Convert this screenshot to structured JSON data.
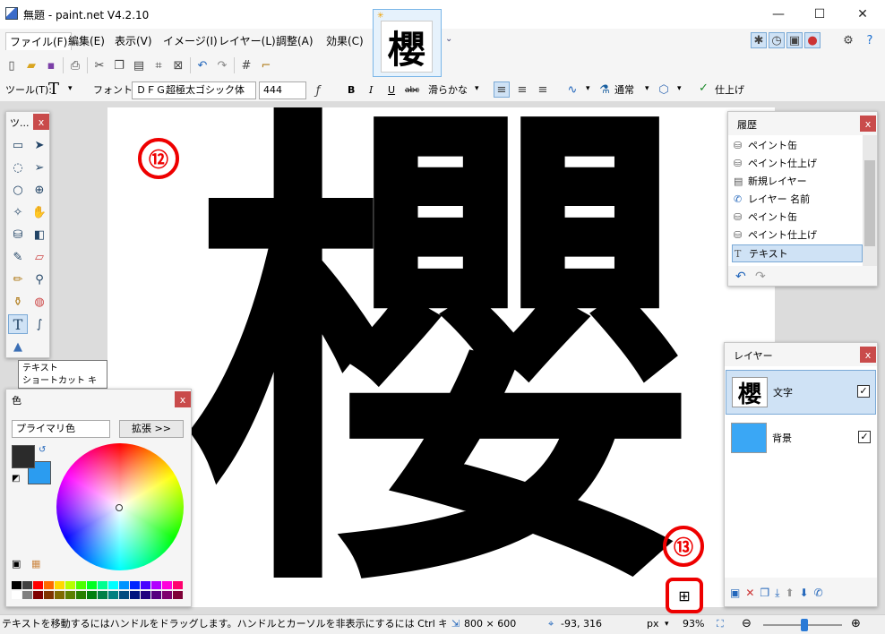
{
  "window": {
    "title": "無題 - paint.net V4.2.10",
    "minimize_glyph": "—",
    "maximize_glyph": "☐",
    "close_glyph": "✕"
  },
  "menu": [
    "ファイル(F)",
    "編集(E)",
    "表示(V)",
    "イメージ(I)",
    "レイヤー(L)",
    "調整(A)",
    "効果(C)"
  ],
  "image_tab": {
    "thumb_char": "櫻"
  },
  "toolbar2": {
    "tool_label": "ツール(T):",
    "tool_glyph": "T",
    "font_label": "フォント:",
    "font_value": "ＤＦＧ超極太ゴシック体",
    "size_value": "444",
    "bold": "B",
    "italic": "I",
    "underline": "U",
    "strike": "abc",
    "antialias": "滑らかな",
    "blend": "通常",
    "finish": "仕上げ"
  },
  "canvas": {
    "text": "櫻",
    "background": "#ffffff"
  },
  "markers": {
    "m12": "⑫",
    "m13": "⑬"
  },
  "tools_panel": {
    "title": "ツ..."
  },
  "tooltip": {
    "line1": "テキスト",
    "line2": "ショートカット キー: T"
  },
  "color_panel": {
    "title": "色",
    "mode": "プライマリ色",
    "expand": "拡張 >>",
    "primary": "#2b2b2b",
    "secondary": "#2b9cf0",
    "palette": [
      "#000000",
      "#404040",
      "#ff0000",
      "#ff6a00",
      "#ffd800",
      "#b6ff00",
      "#4cff00",
      "#00ff21",
      "#00ff90",
      "#00ffff",
      "#0094ff",
      "#0026ff",
      "#4800ff",
      "#b200ff",
      "#ff00dc",
      "#ff006e",
      "#ffffff",
      "#808080",
      "#7f0000",
      "#7f3300",
      "#7f6a00",
      "#5b7f00",
      "#267f00",
      "#007f0e",
      "#007f46",
      "#007f7f",
      "#004a7f",
      "#00137f",
      "#21007f",
      "#57007f",
      "#7f006e",
      "#7f0037"
    ]
  },
  "history_panel": {
    "title": "履歴",
    "items": [
      {
        "label": "ペイント缶",
        "icon": "paint-bucket-icon"
      },
      {
        "label": "ペイント仕上げ",
        "icon": "paint-bucket-icon"
      },
      {
        "label": "新規レイヤー",
        "icon": "new-layer-icon"
      },
      {
        "label": "レイヤー 名前",
        "icon": "wrench-icon"
      },
      {
        "label": "ペイント缶",
        "icon": "paint-bucket-icon"
      },
      {
        "label": "ペイント仕上げ",
        "icon": "paint-bucket-icon"
      },
      {
        "label": "テキスト",
        "icon": "text-icon"
      }
    ]
  },
  "layers_panel": {
    "title": "レイヤー",
    "layers": [
      {
        "name": "文字",
        "thumb": "櫻",
        "checked": "✓"
      },
      {
        "name": "背景",
        "thumb": "",
        "checked": "✓"
      }
    ],
    "bg_color": "#3aa7f5"
  },
  "status": {
    "hint": "テキストを移動するにはハンドルをドラッグします。ハンドルとカーソルを非表示にするには Ctrl キーを押下します。",
    "image_size": "800 × 600",
    "cursor": "-93, 316",
    "unit": "px",
    "zoom": "93%"
  }
}
